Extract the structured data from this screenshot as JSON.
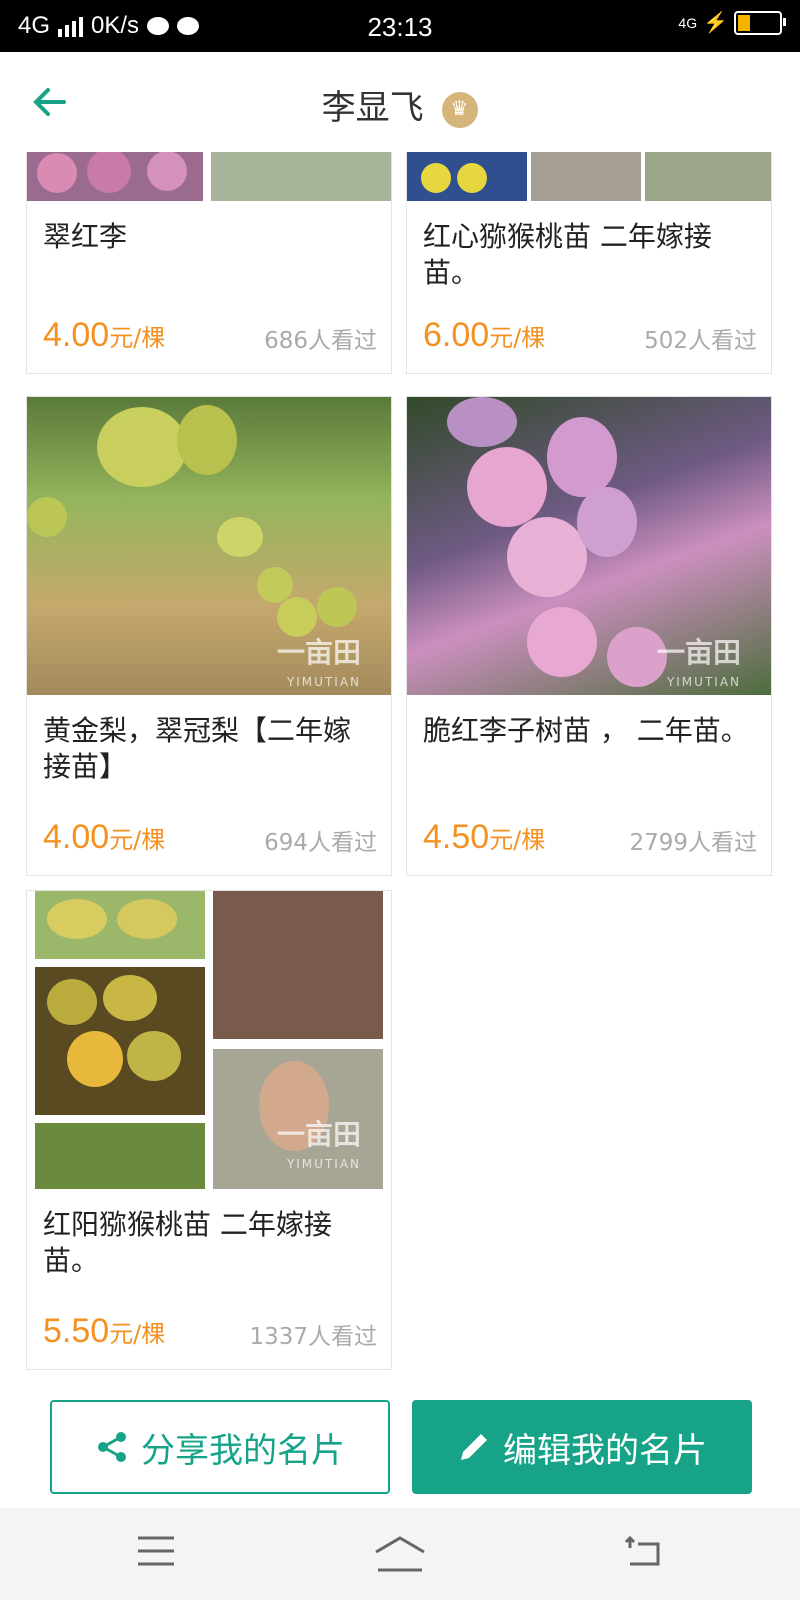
{
  "status_bar": {
    "network": "4G",
    "speed": "0K/s",
    "time": "23:13",
    "right_network": "4G"
  },
  "header": {
    "title": "李显飞",
    "back_icon": "arrow-left-icon",
    "badge_icon": "crown-icon"
  },
  "products": [
    {
      "name": "翠红李",
      "price": "4.00",
      "unit": "元/棵",
      "views": "686人看过"
    },
    {
      "name": "红心猕猴桃苗  二年嫁接苗。",
      "price": "6.00",
      "unit": "元/棵",
      "views": "502人看过"
    },
    {
      "name": "黄金梨，翠冠梨【二年嫁接苗】",
      "price": "4.00",
      "unit": "元/棵",
      "views": "694人看过"
    },
    {
      "name": "脆红李子树苗 ， 二年苗。",
      "price": "4.50",
      "unit": "元/棵",
      "views": "2799人看过"
    },
    {
      "name": "红阳猕猴桃苗 二年嫁接苗。",
      "price": "5.50",
      "unit": "元/棵",
      "views": "1337人看过"
    }
  ],
  "watermark": {
    "brand": "一亩田",
    "latin": "YIMUTIAN"
  },
  "actions": {
    "share_label": "分享我的名片",
    "edit_label": "编辑我的名片",
    "share_icon": "share-icon",
    "edit_icon": "pencil-icon"
  },
  "colors": {
    "accent": "#17a388",
    "price": "#f39222",
    "muted": "#aaaaaa"
  },
  "nav": {
    "menu_icon": "menu-icon",
    "home_icon": "home-icon",
    "back_icon": "back-icon"
  }
}
